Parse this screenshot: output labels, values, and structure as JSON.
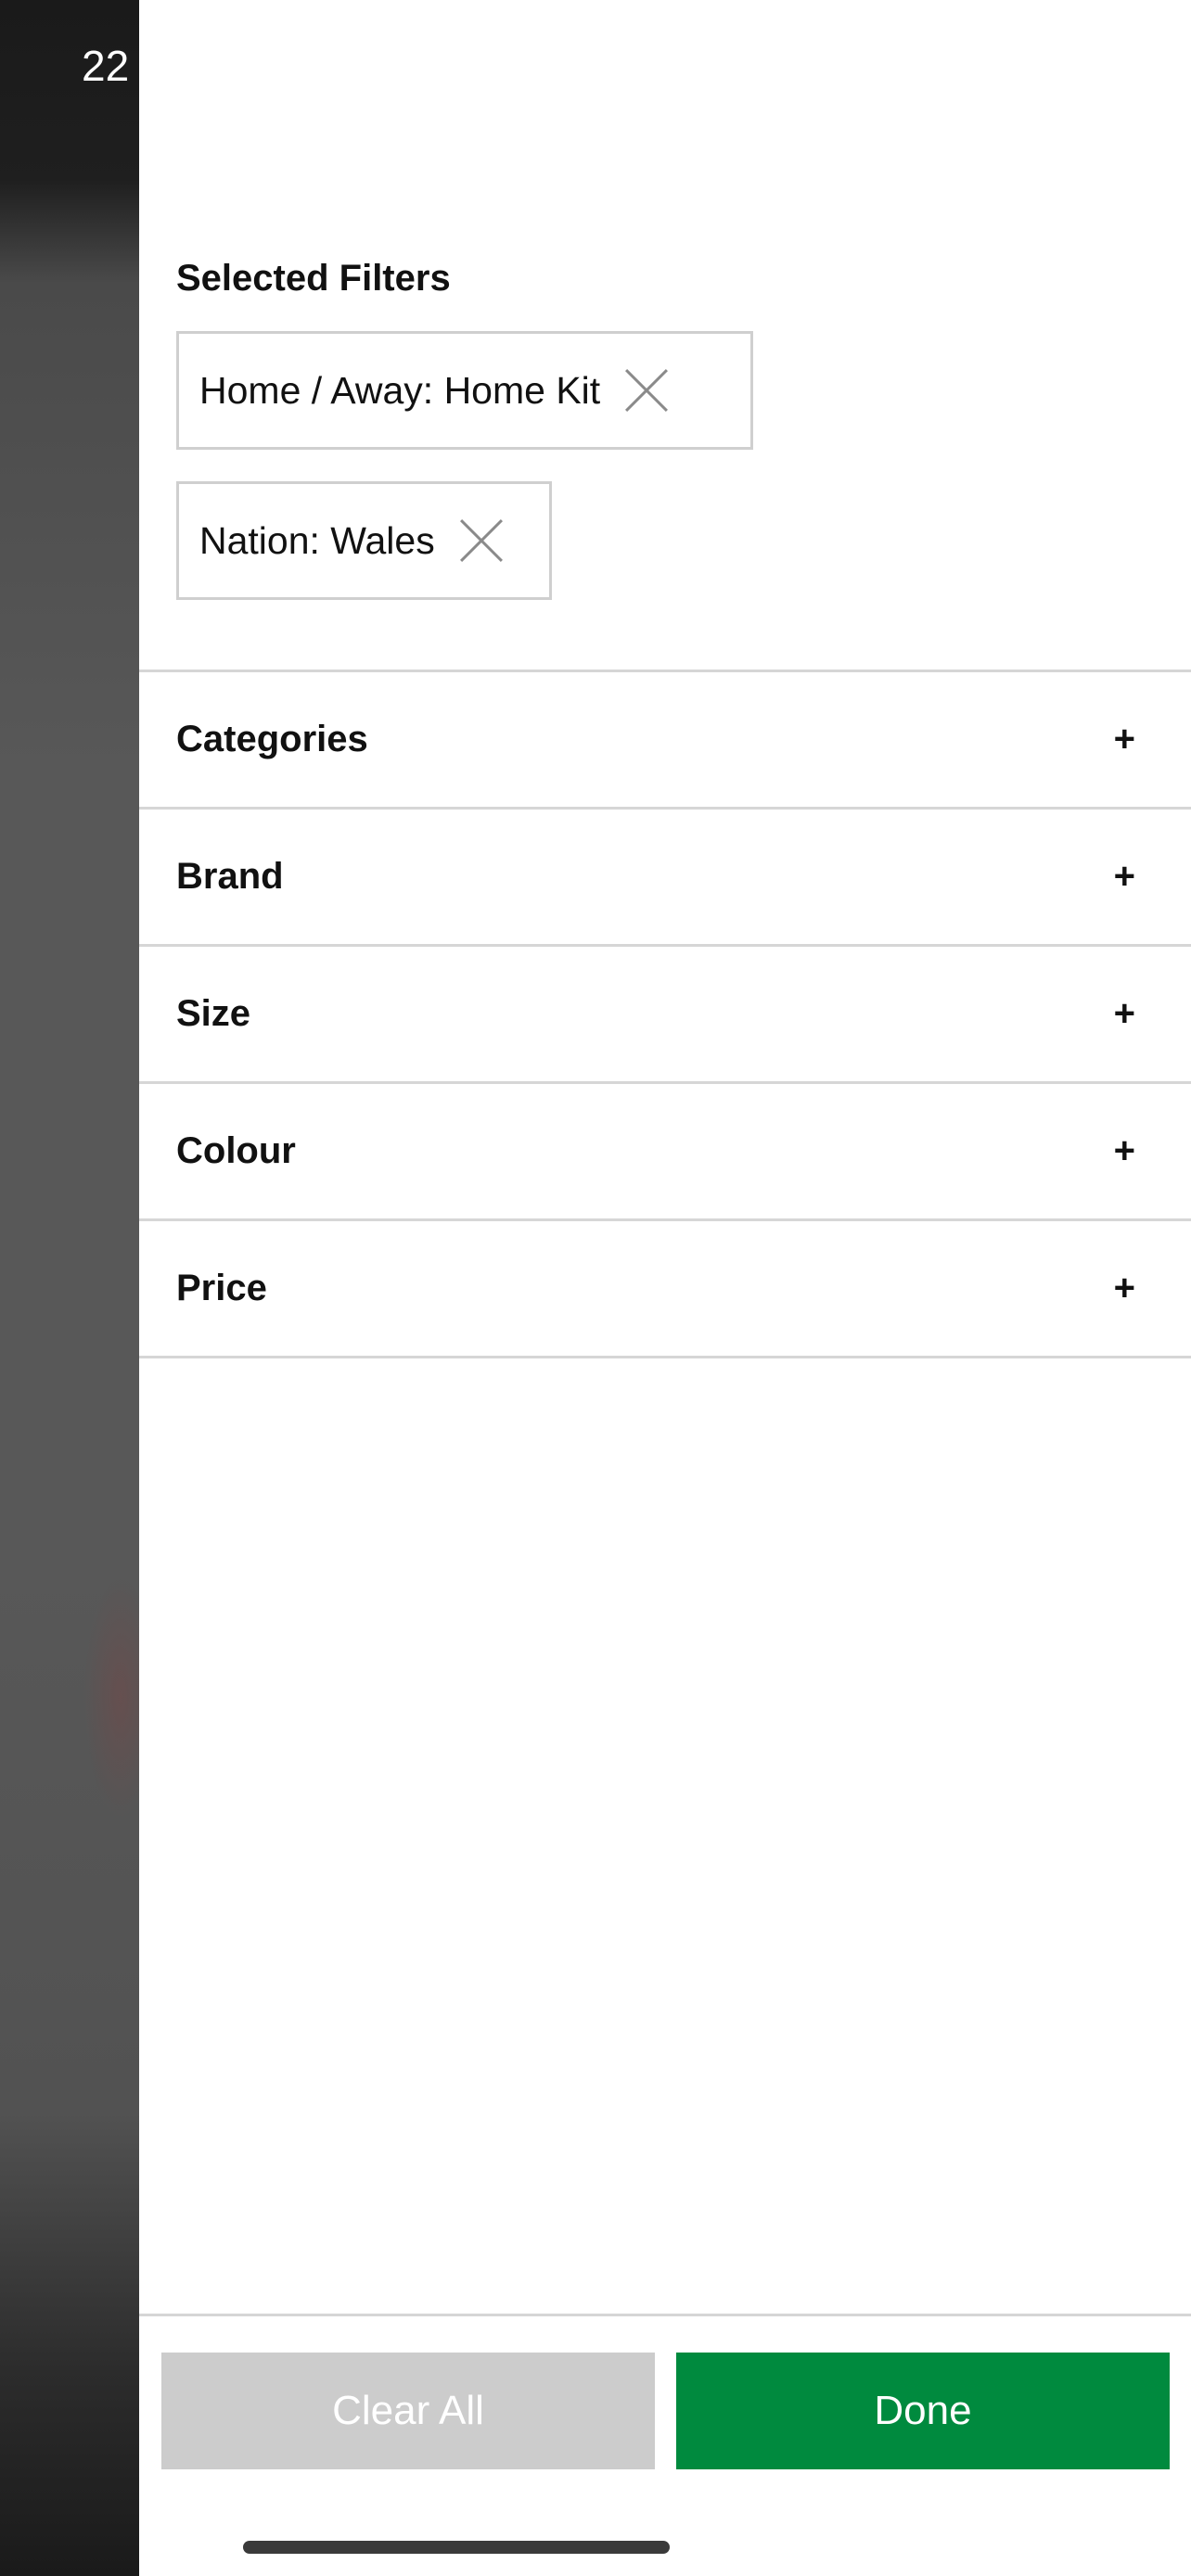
{
  "status_bar": {
    "time": "22"
  },
  "filters": {
    "title": "Selected Filters",
    "selected": [
      {
        "label": "Home / Away: Home Kit"
      },
      {
        "label": "Nation: Wales"
      }
    ],
    "remove_icon": "close-icon"
  },
  "accordion": {
    "items": [
      {
        "label": "Categories",
        "toggle": "+"
      },
      {
        "label": "Brand",
        "toggle": "+"
      },
      {
        "label": "Size",
        "toggle": "+"
      },
      {
        "label": "Colour",
        "toggle": "+"
      },
      {
        "label": "Price",
        "toggle": "+"
      }
    ]
  },
  "footer": {
    "clear_label": "Clear All",
    "done_label": "Done"
  },
  "colors": {
    "done_green": "#008a3e",
    "clear_gray": "#cccccc",
    "divider": "#d6d6d6"
  }
}
